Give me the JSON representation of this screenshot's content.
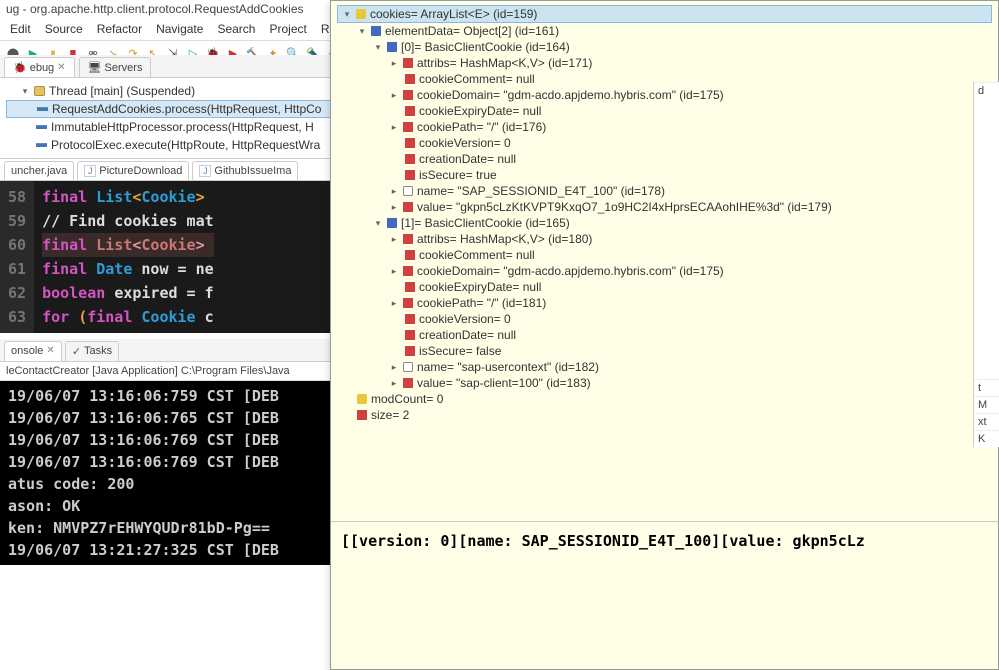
{
  "title": "ug - org.apache.http.client.protocol.RequestAddCookies",
  "menu": {
    "edit": "Edit",
    "source": "Source",
    "refactor": "Refactor",
    "navigate": "Navigate",
    "search": "Search",
    "project": "Project",
    "run": "Run"
  },
  "views": {
    "debug": "ebug",
    "servers": "Servers",
    "console": "onsole",
    "tasks": "Tasks"
  },
  "thread": {
    "label": "Thread [main] (Suspended)",
    "f0": "RequestAddCookies.process(HttpRequest, HttpCo",
    "f1": "ImmutableHttpProcessor.process(HttpRequest, H",
    "f2": "ProtocolExec.execute(HttpRoute, HttpRequestWra"
  },
  "files": {
    "launcher": "uncher.java",
    "picture": "PictureDownload",
    "github": "GithubIssueIma"
  },
  "code": {
    "ln": [
      "58",
      "59",
      "60",
      "61",
      "62",
      "63"
    ],
    "l58": {
      "a": "final ",
      "b": "List",
      "c": "Cookie"
    },
    "l59": "// Find cookies mat",
    "l60": {
      "a": "final ",
      "b": "List",
      "c": "Cookie"
    },
    "l61": {
      "a": "final ",
      "b": "Date ",
      "c": "now = ne"
    },
    "l62": {
      "a": "boolean ",
      "b": "expired = f"
    },
    "l63": {
      "a": "for ",
      "b": "(",
      "c": "final ",
      "d": "Cookie ",
      "e": "c"
    }
  },
  "consoleInfo": "leContactCreator [Java Application] C:\\Program Files\\Java",
  "consoleLines": [
    "19/06/07 13:16:06:759 CST [DEB",
    "19/06/07 13:16:06:765 CST [DEB",
    "19/06/07 13:16:06:769 CST [DEB",
    "19/06/07 13:16:06:769 CST [DEB",
    "atus code: 200",
    "ason: OK",
    "ken: NMVPZ7rEHWYQUDr81bD-Pg==",
    "19/06/07 13:21:27:325 CST [DEB"
  ],
  "vars": {
    "root": "cookies= ArrayList<E>  (id=159)",
    "ed": "elementData= Object[2]  (id=161)",
    "i0": "[0]= BasicClientCookie  (id=164)",
    "i0_attr": "attribs= HashMap<K,V>  (id=171)",
    "i0_comment": "cookieComment= null",
    "i0_domain": "cookieDomain= \"gdm-acdo.apjdemo.hybris.com\" (id=175)",
    "i0_expiry": "cookieExpiryDate= null",
    "i0_path": "cookiePath= \"/\" (id=176)",
    "i0_ver": "cookieVersion= 0",
    "i0_cdate": "creationDate= null",
    "i0_secure": "isSecure= true",
    "i0_name": "name= \"SAP_SESSIONID_E4T_100\" (id=178)",
    "i0_value": "value= \"gkpn5cLzKtKVPT9KxqO7_1o9HC2I4xHprsECAAohIHE%3d\" (id=179)",
    "i1": "[1]= BasicClientCookie  (id=165)",
    "i1_attr": "attribs= HashMap<K,V>  (id=180)",
    "i1_comment": "cookieComment= null",
    "i1_domain": "cookieDomain= \"gdm-acdo.apjdemo.hybris.com\" (id=175)",
    "i1_expiry": "cookieExpiryDate= null",
    "i1_path": "cookiePath= \"/\" (id=181)",
    "i1_ver": "cookieVersion= 0",
    "i1_cdate": "creationDate= null",
    "i1_secure": "isSecure= false",
    "i1_name": "name= \"sap-usercontext\" (id=182)",
    "i1_value": "value= \"sap-client=100\" (id=183)",
    "modCount": "modCount= 0",
    "size": "size= 2"
  },
  "popupVal": "[[version: 0][name: SAP_SESSIONID_E4T_100][value: gkpn5cLz",
  "right": {
    "d": "d",
    "t": "t",
    "m": "M",
    "x": "xt",
    "k": "K"
  }
}
